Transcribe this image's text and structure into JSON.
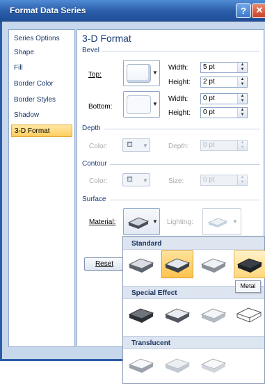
{
  "window": {
    "title": "Format Data Series",
    "help": "?",
    "close": "✕"
  },
  "nav": {
    "items": [
      {
        "label": "Series Options",
        "active": false
      },
      {
        "label": "Shape",
        "active": false
      },
      {
        "label": "Fill",
        "active": false
      },
      {
        "label": "Border Color",
        "active": false
      },
      {
        "label": "Border Styles",
        "active": false
      },
      {
        "label": "Shadow",
        "active": false
      },
      {
        "label": "3-D Format",
        "active": true
      }
    ]
  },
  "panel": {
    "heading": "3-D Format",
    "bevel": {
      "section": "Bevel",
      "top_label": "Top:",
      "bottom_label": "Bottom:",
      "top_width_label": "Width:",
      "top_width_value": "5 pt",
      "top_height_label": "Height:",
      "top_height_value": "2 pt",
      "bottom_width_label": "Width:",
      "bottom_width_value": "0 pt",
      "bottom_height_label": "Height:",
      "bottom_height_value": "0 pt"
    },
    "depth": {
      "section": "Depth",
      "color_label": "Color:",
      "depth_label": "Depth:",
      "depth_value": "0 pt"
    },
    "contour": {
      "section": "Contour",
      "color_label": "Color:",
      "size_label": "Size:",
      "size_value": "0 pt"
    },
    "surface": {
      "section": "Surface",
      "material_label": "Material:",
      "lighting_label": "Lighting:"
    },
    "reset_label": "Reset"
  },
  "gallery": {
    "standard": "Standard",
    "special_effect": "Special Effect",
    "translucent": "Translucent",
    "tooltip": "Metal"
  },
  "colors": {
    "title_bar": "#2a5ca8",
    "client_bg": "#c7d7ec",
    "selection": "#ffce5f",
    "heading": "#1a3b75"
  }
}
